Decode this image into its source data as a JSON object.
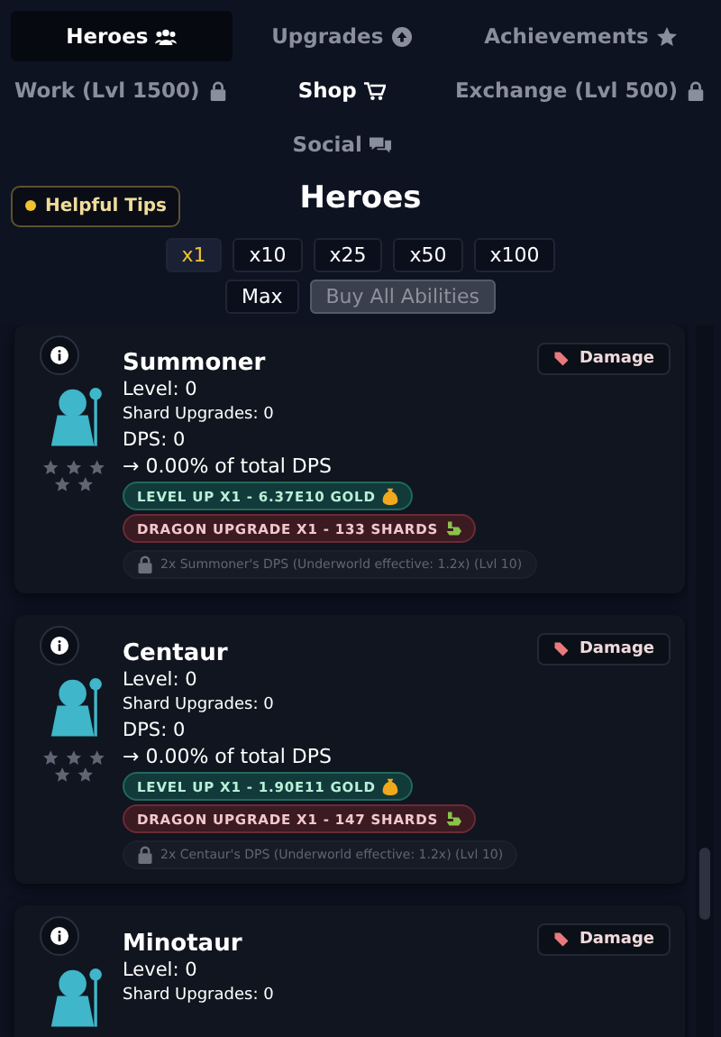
{
  "nav_tabs": [
    {
      "label": "Heroes",
      "kind": "people",
      "selected": true,
      "highlight": false
    },
    {
      "label": "Upgrades",
      "kind": "arrow",
      "selected": false,
      "highlight": false
    },
    {
      "label": "Achievements",
      "kind": "star",
      "selected": false,
      "highlight": false
    },
    {
      "label": "Work (Lvl 1500)",
      "kind": "lock",
      "selected": false,
      "highlight": false
    },
    {
      "label": "Shop",
      "kind": "cart",
      "selected": false,
      "highlight": true
    },
    {
      "label": "Exchange (Lvl 500)",
      "kind": "lock",
      "selected": false,
      "highlight": false
    },
    {
      "label": "Social",
      "kind": "chat",
      "selected": false,
      "highlight": false
    }
  ],
  "tips_button": "Helpful Tips",
  "title": "Heroes",
  "multipliers": [
    {
      "label": "x1",
      "selected": true
    },
    {
      "label": "x10",
      "selected": false
    },
    {
      "label": "x25",
      "selected": false
    },
    {
      "label": "x50",
      "selected": false
    },
    {
      "label": "x100",
      "selected": false
    }
  ],
  "max_button": {
    "label": "Max",
    "disabled": false
  },
  "buy_all_button": {
    "label": "Buy All Abilities",
    "disabled": true
  },
  "heroes": [
    {
      "name": "Summoner",
      "tag": "Damage",
      "level": "Level: 0",
      "shard_upgrades": "Shard Upgrades: 0",
      "dps": "DPS: 0",
      "share": "→ 0.00% of total DPS",
      "level_up": "LEVEL UP X1 - 6.37E10 GOLD",
      "dragon_upgrade": "DRAGON UPGRADE X1 - 133 SHARDS",
      "ability": "2x Summoner's DPS (Underworld effective: 1.2x) (Lvl 10)",
      "ability_locked": true
    },
    {
      "name": "Centaur",
      "tag": "Damage",
      "level": "Level: 0",
      "shard_upgrades": "Shard Upgrades: 0",
      "dps": "DPS: 0",
      "share": "→ 0.00% of total DPS",
      "level_up": "LEVEL UP X1 - 1.90E11 GOLD",
      "dragon_upgrade": "DRAGON UPGRADE X1 - 147 SHARDS",
      "ability": "2x Centaur's DPS (Underworld effective: 1.2x) (Lvl 10)",
      "ability_locked": true
    },
    {
      "name": "Minotaur",
      "tag": "Damage",
      "level": "Level: 0",
      "shard_upgrades": "Shard Upgrades: 0"
    }
  ]
}
